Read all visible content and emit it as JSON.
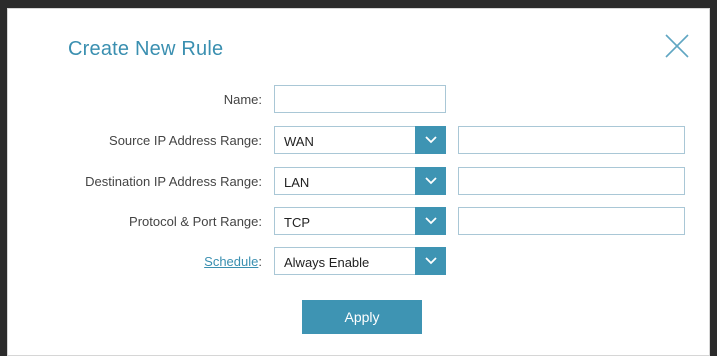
{
  "dialog": {
    "title": "Create New Rule",
    "close_icon": "close-icon"
  },
  "form": {
    "name": {
      "label": "Name:",
      "value": ""
    },
    "source_ip": {
      "label": "Source IP Address Range:",
      "selected": "WAN",
      "value": ""
    },
    "destination_ip": {
      "label": "Destination IP Address Range:",
      "selected": "LAN",
      "value": ""
    },
    "protocol": {
      "label": "Protocol & Port Range:",
      "selected": "TCP",
      "value": ""
    },
    "schedule": {
      "link_label": "Schedule",
      "colon": ":",
      "selected": "Always Enable"
    }
  },
  "apply_label": "Apply",
  "colors": {
    "accent": "#3e94b3",
    "title": "#3a8fb0",
    "border": "#a9c7d6"
  }
}
